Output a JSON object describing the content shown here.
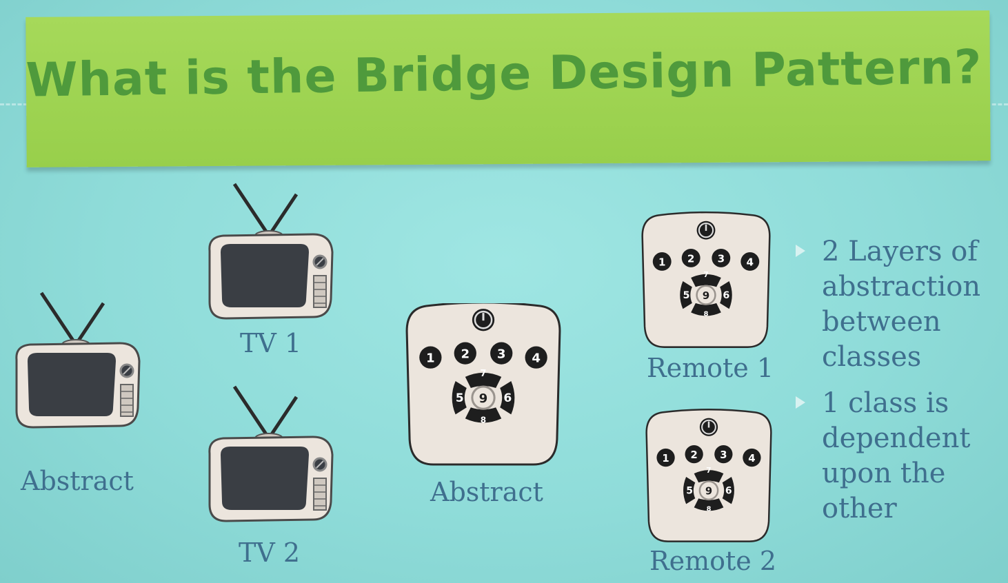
{
  "slide": {
    "title": "What is the Bridge Design Pattern?",
    "labels": {
      "tv_abstract": "Abstract",
      "tv1": "TV 1",
      "tv2": "TV 2",
      "remote_abstract": "Abstract",
      "remote1": "Remote 1",
      "remote2": "Remote 2"
    },
    "bullets": [
      "2 Layers of abstraction between classes",
      "1 class is dependent upon the other"
    ],
    "remote_buttons": {
      "top_row": [
        "1",
        "2",
        "3",
        "4"
      ],
      "cross": {
        "up": "7",
        "left": "5",
        "center": "9",
        "right": "6",
        "down": "8"
      }
    },
    "colors": {
      "background": "#8fdcd9",
      "banner": "#9fd452",
      "title_text": "#4f9a3c",
      "label_text": "#3f6f8e",
      "tv_screen": "#3a3e44",
      "device_body": "#ece5dd"
    },
    "icons": [
      "television-icon",
      "remote-control-icon",
      "power-icon",
      "bullet-triangle-icon"
    ]
  }
}
